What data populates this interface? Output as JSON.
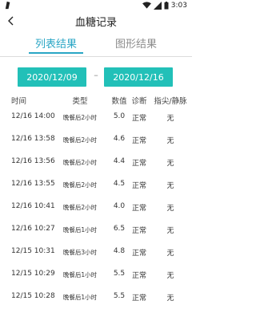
{
  "status": {
    "time": "3:03"
  },
  "header": {
    "title": "血糖记录"
  },
  "tabs": [
    {
      "label": "列表结果",
      "active": true
    },
    {
      "label": "图形结果",
      "active": false
    }
  ],
  "date_range": {
    "start": "2020/12/09",
    "separator": "–",
    "end": "2020/12/16"
  },
  "table": {
    "columns": [
      "时间",
      "类型",
      "数值",
      "诊断",
      "指尖/静脉"
    ],
    "rows": [
      {
        "time": "12/16  14:00",
        "type": "晚餐后2小时",
        "value": "5.0",
        "diagnosis": "正常",
        "source": "无"
      },
      {
        "time": "12/16  13:58",
        "type": "晚餐后2小时",
        "value": "4.6",
        "diagnosis": "正常",
        "source": "无"
      },
      {
        "time": "12/16  13:56",
        "type": "晚餐后2小时",
        "value": "4.4",
        "diagnosis": "正常",
        "source": "无"
      },
      {
        "time": "12/16  13:55",
        "type": "晚餐后2小时",
        "value": "4.5",
        "diagnosis": "正常",
        "source": "无"
      },
      {
        "time": "12/16  10:41",
        "type": "晚餐后2小时",
        "value": "4.0",
        "diagnosis": "正常",
        "source": "无"
      },
      {
        "time": "12/16  10:27",
        "type": "晚餐后1小时",
        "value": "6.5",
        "diagnosis": "正常",
        "source": "无"
      },
      {
        "time": "12/15  10:31",
        "type": "晚餐后3小时",
        "value": "4.8",
        "diagnosis": "正常",
        "source": "无"
      },
      {
        "time": "12/15  10:29",
        "type": "晚餐后1小时",
        "value": "5.5",
        "diagnosis": "正常",
        "source": "无"
      },
      {
        "time": "12/15  10:28",
        "type": "晚餐后1小时",
        "value": "5.5",
        "diagnosis": "正常",
        "source": "无"
      }
    ]
  },
  "colors": {
    "accent": "#2aa6c5",
    "date_button": "#22c0b8"
  }
}
